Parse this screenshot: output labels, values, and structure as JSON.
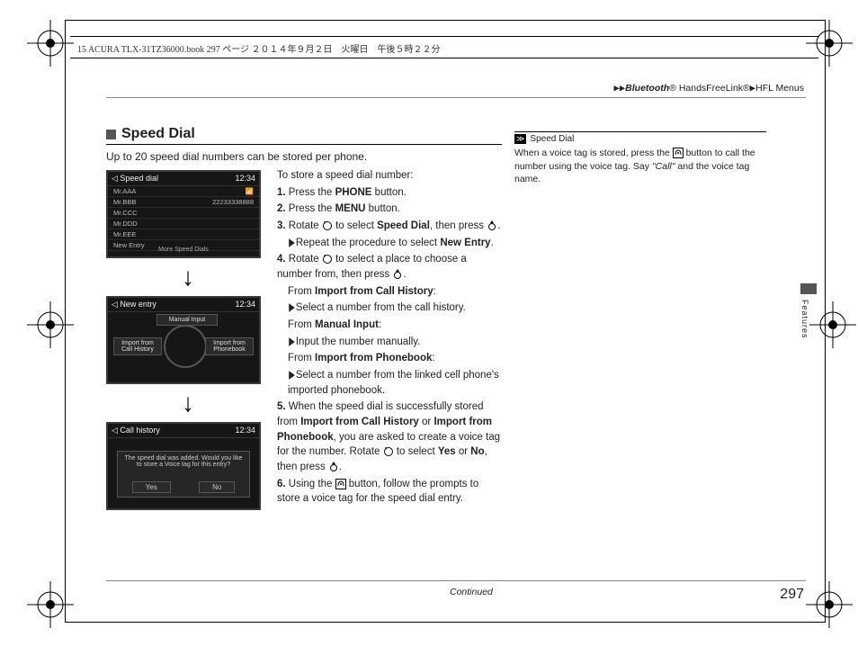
{
  "header": {
    "running": "15 ACURA TLX-31TZ36000.book  297 ページ  ２０１４年９月２日　火曜日　午後５時２２分"
  },
  "breadcrumb": {
    "a": "Bluetooth",
    "b": "HandsFreeLink®",
    "c": "HFL Menus"
  },
  "section": {
    "title": "Speed Dial",
    "intro": "Up to 20 speed dial numbers can be stored per phone.",
    "lead": "To store a speed dial number:"
  },
  "screens": {
    "s1": {
      "title": "Speed dial",
      "time": "12:34",
      "rows": [
        "Mr.AAA",
        "Mr.BBB",
        "Mr.CCC",
        "Mr.DDD",
        "Mr.EEE",
        "New Entry"
      ],
      "num2": "22233338888",
      "foot": "More Speed Dials"
    },
    "s2": {
      "title": "New entry",
      "time": "12:34",
      "btn_top": "Manual Input",
      "btn_l": "Import from Call History",
      "btn_r": "Import from Phonebook"
    },
    "s3": {
      "title": "Call history",
      "time": "12:34",
      "msg": "The speed dial was added. Would you like to store a Voice tag for this entry?",
      "yes": "Yes",
      "no": "No"
    }
  },
  "steps": {
    "s1a": "Press the ",
    "s1b": "PHONE",
    "s1c": " button.",
    "s2a": "Press the ",
    "s2b": "MENU",
    "s2c": " button.",
    "s3a": "Rotate ",
    "s3b": " to select ",
    "s3c": "Speed Dial",
    "s3d": ", then press ",
    "s3e": ".",
    "s3_sub_a": "Repeat the procedure to select ",
    "s3_sub_b": "New Entry",
    "s3_sub_c": ".",
    "s4a": "Rotate ",
    "s4b": " to select a place to choose a number from, then press ",
    "s4c": ".",
    "s4_h1a": "From ",
    "s4_h1b": "Import from Call History",
    "s4_h1c": ":",
    "s4_l1": "Select a number from the call history.",
    "s4_h2a": "From ",
    "s4_h2b": "Manual Input",
    "s4_h2c": ":",
    "s4_l2": "Input the number manually.",
    "s4_h3a": "From ",
    "s4_h3b": "Import from Phonebook",
    "s4_h3c": ":",
    "s4_l3": "Select a number from the linked cell phone's imported phonebook.",
    "s5a": "When the speed dial is successfully stored from ",
    "s5b": "Import from Call History",
    "s5c": " or ",
    "s5d": "Import from Phonebook",
    "s5e": ", you are asked to create a voice tag for the number. Rotate ",
    "s5f": " to select ",
    "s5g": "Yes",
    "s5h": " or ",
    "s5i": "No",
    "s5j": ", then press ",
    "s5k": ".",
    "s6a": "Using the ",
    "s6b": " button, follow the prompts to store a voice tag for the speed dial entry."
  },
  "sidenote": {
    "header": "Speed Dial",
    "l1": "When a voice tag is stored, press the ",
    "l2": " button to call the number using the voice tag. Say ",
    "l3": "\"Call\"",
    "l4": " and the voice tag name."
  },
  "tab": {
    "label": "Features"
  },
  "footer": {
    "continued": "Continued",
    "page": "297"
  }
}
